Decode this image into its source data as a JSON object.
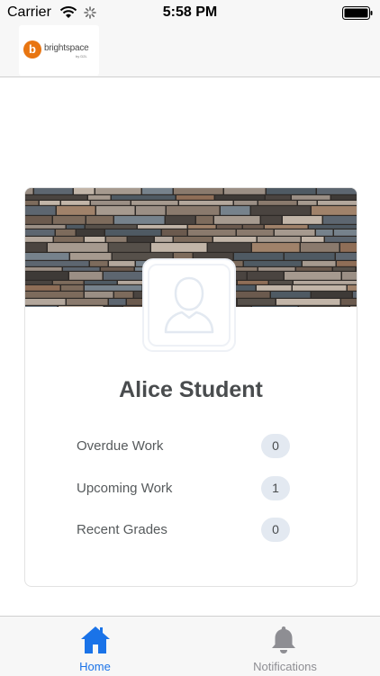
{
  "status_bar": {
    "carrier": "Carrier",
    "time": "5:58 PM"
  },
  "header": {
    "logo_text": "brightspace",
    "logo_sub": "by D2L",
    "logo_letter": "b"
  },
  "profile": {
    "name": "Alice Student"
  },
  "stats": [
    {
      "label": "Overdue Work",
      "count": "0"
    },
    {
      "label": "Upcoming Work",
      "count": "1"
    },
    {
      "label": "Recent Grades",
      "count": "0"
    }
  ],
  "tabs": [
    {
      "label": "Home",
      "icon": "home-icon",
      "active": true
    },
    {
      "label": "Notifications",
      "icon": "bell-icon",
      "active": false
    }
  ],
  "colors": {
    "accent": "#1a73e8",
    "inactive": "#8e8e93",
    "brand": "#e87511"
  }
}
